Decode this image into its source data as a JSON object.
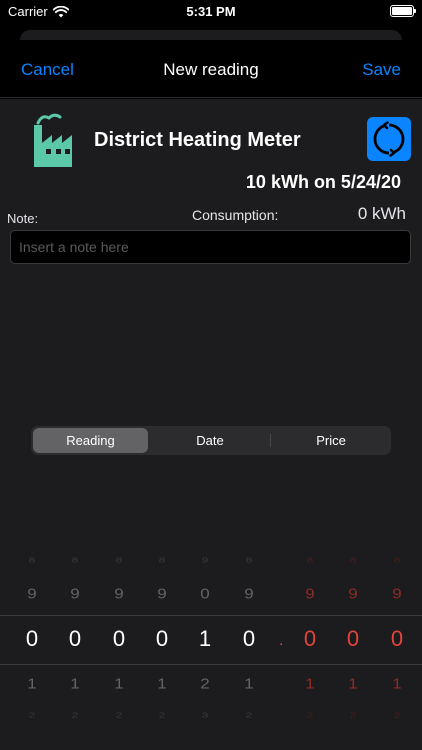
{
  "status_bar": {
    "carrier": "Carrier",
    "time": "5:31 PM"
  },
  "nav": {
    "cancel_label": "Cancel",
    "title": "New reading",
    "save_label": "Save"
  },
  "meter": {
    "name": "District Heating Meter",
    "icon": "factory-icon",
    "last_reading": "10 kWh on 5/24/20"
  },
  "note": {
    "label": "Note:",
    "placeholder": "Insert a note here",
    "value": ""
  },
  "consumption": {
    "label": "Consumption:",
    "value": "0 kWh"
  },
  "segments": {
    "items": [
      "Reading",
      "Date",
      "Price"
    ],
    "selected": "Reading"
  },
  "picker": {
    "columns": [
      {
        "above2": "8",
        "above1": "9",
        "current": "0",
        "below1": "1",
        "below2": "2"
      },
      {
        "above2": "8",
        "above1": "9",
        "current": "0",
        "below1": "1",
        "below2": "2"
      },
      {
        "above2": "8",
        "above1": "9",
        "current": "0",
        "below1": "1",
        "below2": "2"
      },
      {
        "above2": "8",
        "above1": "9",
        "current": "0",
        "below1": "1",
        "below2": "2"
      },
      {
        "above2": "9",
        "above1": "0",
        "current": "1",
        "below1": "2",
        "below2": "3"
      },
      {
        "above2": "8",
        "above1": "9",
        "current": "0",
        "below1": "1",
        "below2": "2"
      },
      {
        "above2": "8",
        "above1": "9",
        "current": "0",
        "below1": "1",
        "below2": "2"
      },
      {
        "above2": "8",
        "above1": "9",
        "current": "0",
        "below1": "1",
        "below2": "2"
      },
      {
        "above2": "8",
        "above1": "9",
        "current": "0",
        "below1": "1",
        "below2": "2"
      }
    ],
    "decimal_separator": "."
  },
  "colors": {
    "accent": "#0a84ff",
    "meter_icon": "#5bc8a8",
    "decimal_digits": "#e0443a"
  }
}
